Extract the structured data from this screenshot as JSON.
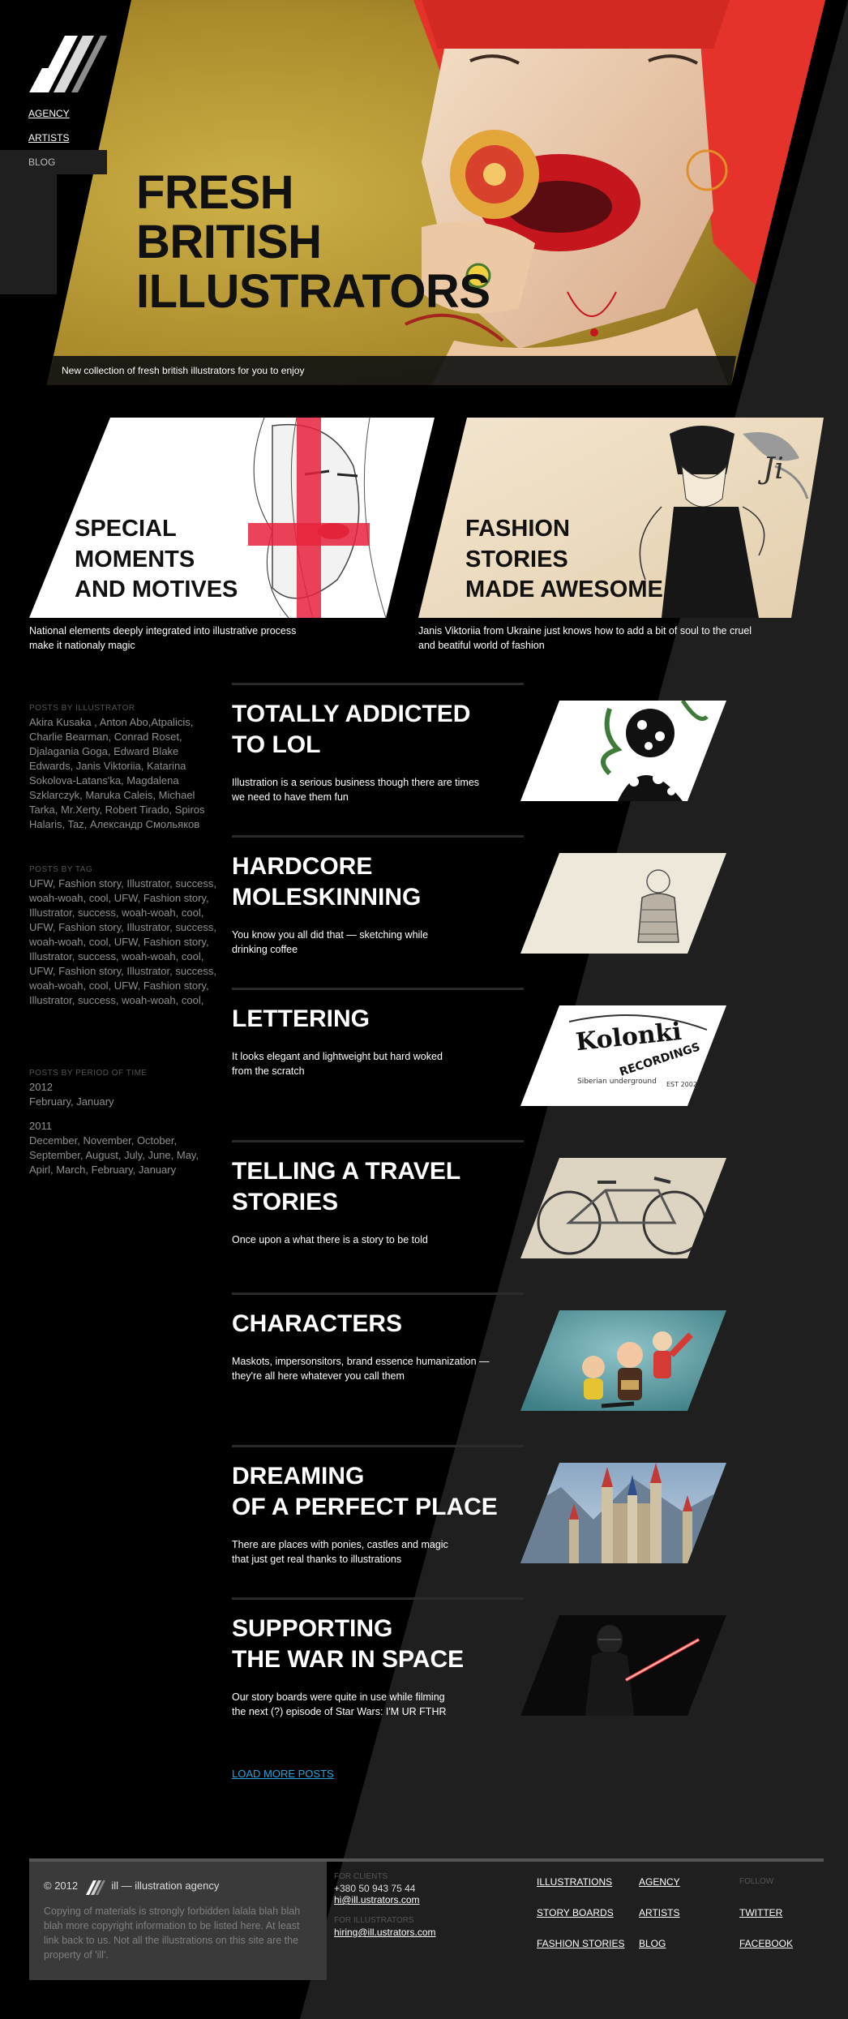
{
  "nav": {
    "items": [
      {
        "label": "AGENCY"
      },
      {
        "label": "ARTISTS"
      },
      {
        "label": "BLOG"
      }
    ]
  },
  "hero": {
    "title_lines": [
      "FRESH",
      "BRITISH",
      "ILLUSTRATORS"
    ],
    "caption": "New collection of fresh british illustrators for you to enjoy"
  },
  "features": [
    {
      "title_lines": [
        "SPECIAL",
        "MOMENTS",
        "AND MOTIVES"
      ],
      "desc_lines": [
        "National elements deeply integrated into illustrative process",
        "make it nationaly magic"
      ]
    },
    {
      "title_lines": [
        "FASHION",
        "STORIES",
        "MADE AWESOME"
      ],
      "desc_lines": [
        "Janis Viktoriia from Ukraine just knows how to add a bit of soul to the cruel",
        "and beatiful world of fashion"
      ]
    }
  ],
  "sidebar": {
    "by_illustrator": {
      "heading": "POSTS BY ILLUSTRATOR",
      "text": "Akira Kusaka , Anton Abo,Atpalicis, Charlie Bearman, Conrad Roset, Djalagania Goga, Edward Blake Edwards, Janis Viktoriia, Katarina Sokolova-Latans'ka, Magdalena Szklarczyk, Maruka Caleis, Michael Tarka, Mr.Xerty, Robert Tirado, Spiros Halaris, Taz, Александр Смольяков"
    },
    "by_tag": {
      "heading": "POSTS BY TAG",
      "text": "UFW, Fashion story, Illustrator, success, woah-woah, cool, UFW, Fashion story, Illustrator, success, woah-woah, cool, UFW, Fashion story, Illustrator, success, woah-woah, cool, UFW, Fashion story, Illustrator, success, woah-woah, cool, UFW, Fashion story, Illustrator, success, woah-woah, cool, UFW, Fashion story, Illustrator, success, woah-woah, cool,"
    },
    "by_period": {
      "heading": "POSTS BY PERIOD OF TIME",
      "years": [
        {
          "year": "2012",
          "months": "February, January"
        },
        {
          "year": "2011",
          "months": "December, November, October, September, August, July, June, May, Apirl, March, February, January"
        }
      ]
    }
  },
  "posts": [
    {
      "title_lines": [
        "TOTALLY ADDICTED",
        "TO LOL"
      ],
      "desc_lines": [
        "Illustration is a serious business though there are times",
        "we need to have them fun"
      ],
      "thumb": "pattern-illustration"
    },
    {
      "title_lines": [
        "HARDCORE",
        "MOLESKINNING"
      ],
      "desc_lines": [
        "You know you all did that — sketching while",
        "drinking coffee"
      ],
      "thumb": "sketch-illustration"
    },
    {
      "title_lines": [
        "LETTERING"
      ],
      "desc_lines": [
        "It looks elegant and lightweight but hard woked",
        "from the scratch"
      ],
      "thumb": "lettering-illustration",
      "thumb_text": [
        "Kolonki",
        "RECORDINGS",
        "Siberian underground",
        "EST 2002"
      ]
    },
    {
      "title_lines": [
        "TELLING A TRAVEL",
        "STORIES"
      ],
      "desc_lines": [
        "Once upon a what there is a story to be told"
      ],
      "thumb": "bicycle-illustration"
    },
    {
      "title_lines": [
        "CHARACTERS"
      ],
      "desc_lines": [
        "Maskots, impersonsitors, brand essence humanization —",
        "they're all here whatever you call them"
      ],
      "thumb": "characters-illustration"
    },
    {
      "title_lines": [
        "DREAMING",
        "OF A PERFECT PLACE"
      ],
      "desc_lines": [
        "There are places with ponies, castles and magic",
        "that just get real thanks to illustrations"
      ],
      "thumb": "castle-illustration"
    },
    {
      "title_lines": [
        "SUPPORTING",
        "THE WAR IN SPACE"
      ],
      "desc_lines": [
        "Our story boards were quite in use while filming",
        "the next (?) episode of Star Wars: I'M UR FTHR"
      ],
      "thumb": "space-illustration"
    }
  ],
  "load_more": "LOAD MORE POSTS",
  "footer": {
    "year": "© 2012",
    "agency": "ill — illustration agency",
    "copyright": "Copying of materials is strongly forbidden lalala blah blah blah more copyright information to be listed here. At least link back to us. Not all the illustrations on this site are the property of 'ill'.",
    "clients_heading": "FOR CLIENTS",
    "clients_phone": "+380 50 943 75 44",
    "clients_email": "hi@ill.ustrators.com",
    "illustrators_heading": "FOR ILLUSTRATORS",
    "illustrators_email": "hiring@ill.ustrators.com",
    "nav_col1": [
      "ILLUSTRATIONS",
      "STORY BOARDS",
      "FASHION STORIES"
    ],
    "nav_col2": [
      "AGENCY",
      "ARTISTS",
      "BLOG"
    ],
    "follow_heading": "FOLLOW",
    "follow_links": [
      "TWITTER",
      "FACEBOOK"
    ]
  },
  "colors": {
    "background": "#000000",
    "diagonal_band": "#1f1f1f",
    "link_accent": "#29a3de",
    "hero_gold": "#b89a30",
    "hair_red": "#e5322a"
  }
}
